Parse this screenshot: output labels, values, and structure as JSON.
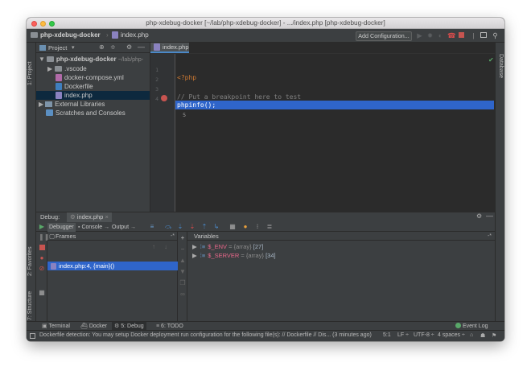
{
  "window": {
    "title": "php-xdebug-docker [~/lab/php-xdebug-docker] - .../index.php [php-xdebug-docker]"
  },
  "navbar": {
    "project_crumb": "php-xdebug-docker",
    "file_crumb": "index.php",
    "add_configuration": "Add Configuration..."
  },
  "left_strip": {
    "project_label": "1: Project",
    "favorites_label": "2: Favorites",
    "structure_label": "7: Structure"
  },
  "right_strip": {
    "database_label": "Database"
  },
  "project_panel": {
    "title": "Project",
    "tree": [
      {
        "label": "php-xdebug-docker",
        "suffix": "~/lab/php-",
        "icon": "folder-icon"
      },
      {
        "label": ".vscode",
        "icon": "folder-icon"
      },
      {
        "label": "docker-compose.yml",
        "icon": "yml-file-icon"
      },
      {
        "label": "Dockerfile",
        "icon": "docker-file-icon"
      },
      {
        "label": "index.php",
        "icon": "php-file-icon"
      },
      {
        "label": "External Libraries",
        "icon": "library-icon"
      },
      {
        "label": "Scratches and Consoles",
        "icon": "scratch-icon"
      }
    ]
  },
  "editor": {
    "tab_label": "index.php",
    "line_numbers": [
      "1",
      "2",
      "3",
      "4",
      "5"
    ],
    "lines": [
      "<?php",
      "",
      "// Put a breakpoint here to test",
      "phpinfo();",
      ""
    ]
  },
  "debug": {
    "label": "Debug:",
    "session_tab": "index.php",
    "tabs": [
      "Debugger",
      "Console",
      "Output"
    ],
    "frames_title": "Frames",
    "frame_item": "index.php:4, {main}()",
    "variables_title": "Variables",
    "variables": [
      {
        "name": "$_ENV",
        "type": "= {array}",
        "count": "[27]"
      },
      {
        "name": "$_SERVER",
        "type": "= {array}",
        "count": "[34]"
      }
    ]
  },
  "bottom_tabs": [
    "Terminal",
    "Docker",
    "5: Debug",
    "6: TODO"
  ],
  "event_log": "Event Log",
  "statusbar": {
    "message": "Dockerfile detection: You may setup Docker deployment run configuration for the following file(s): // Dockerfile // Dis... (3 minutes ago)",
    "position": "5:1",
    "line_separator": "LF",
    "encoding": "UTF-8",
    "indent": "4 spaces"
  },
  "colors": {
    "php_tag": "#cc7832",
    "comment": "#808080",
    "function": "#ffc66d",
    "variable": "#e8678a",
    "selection": "#2f65ca",
    "frame_selection": "#2f65ca"
  }
}
